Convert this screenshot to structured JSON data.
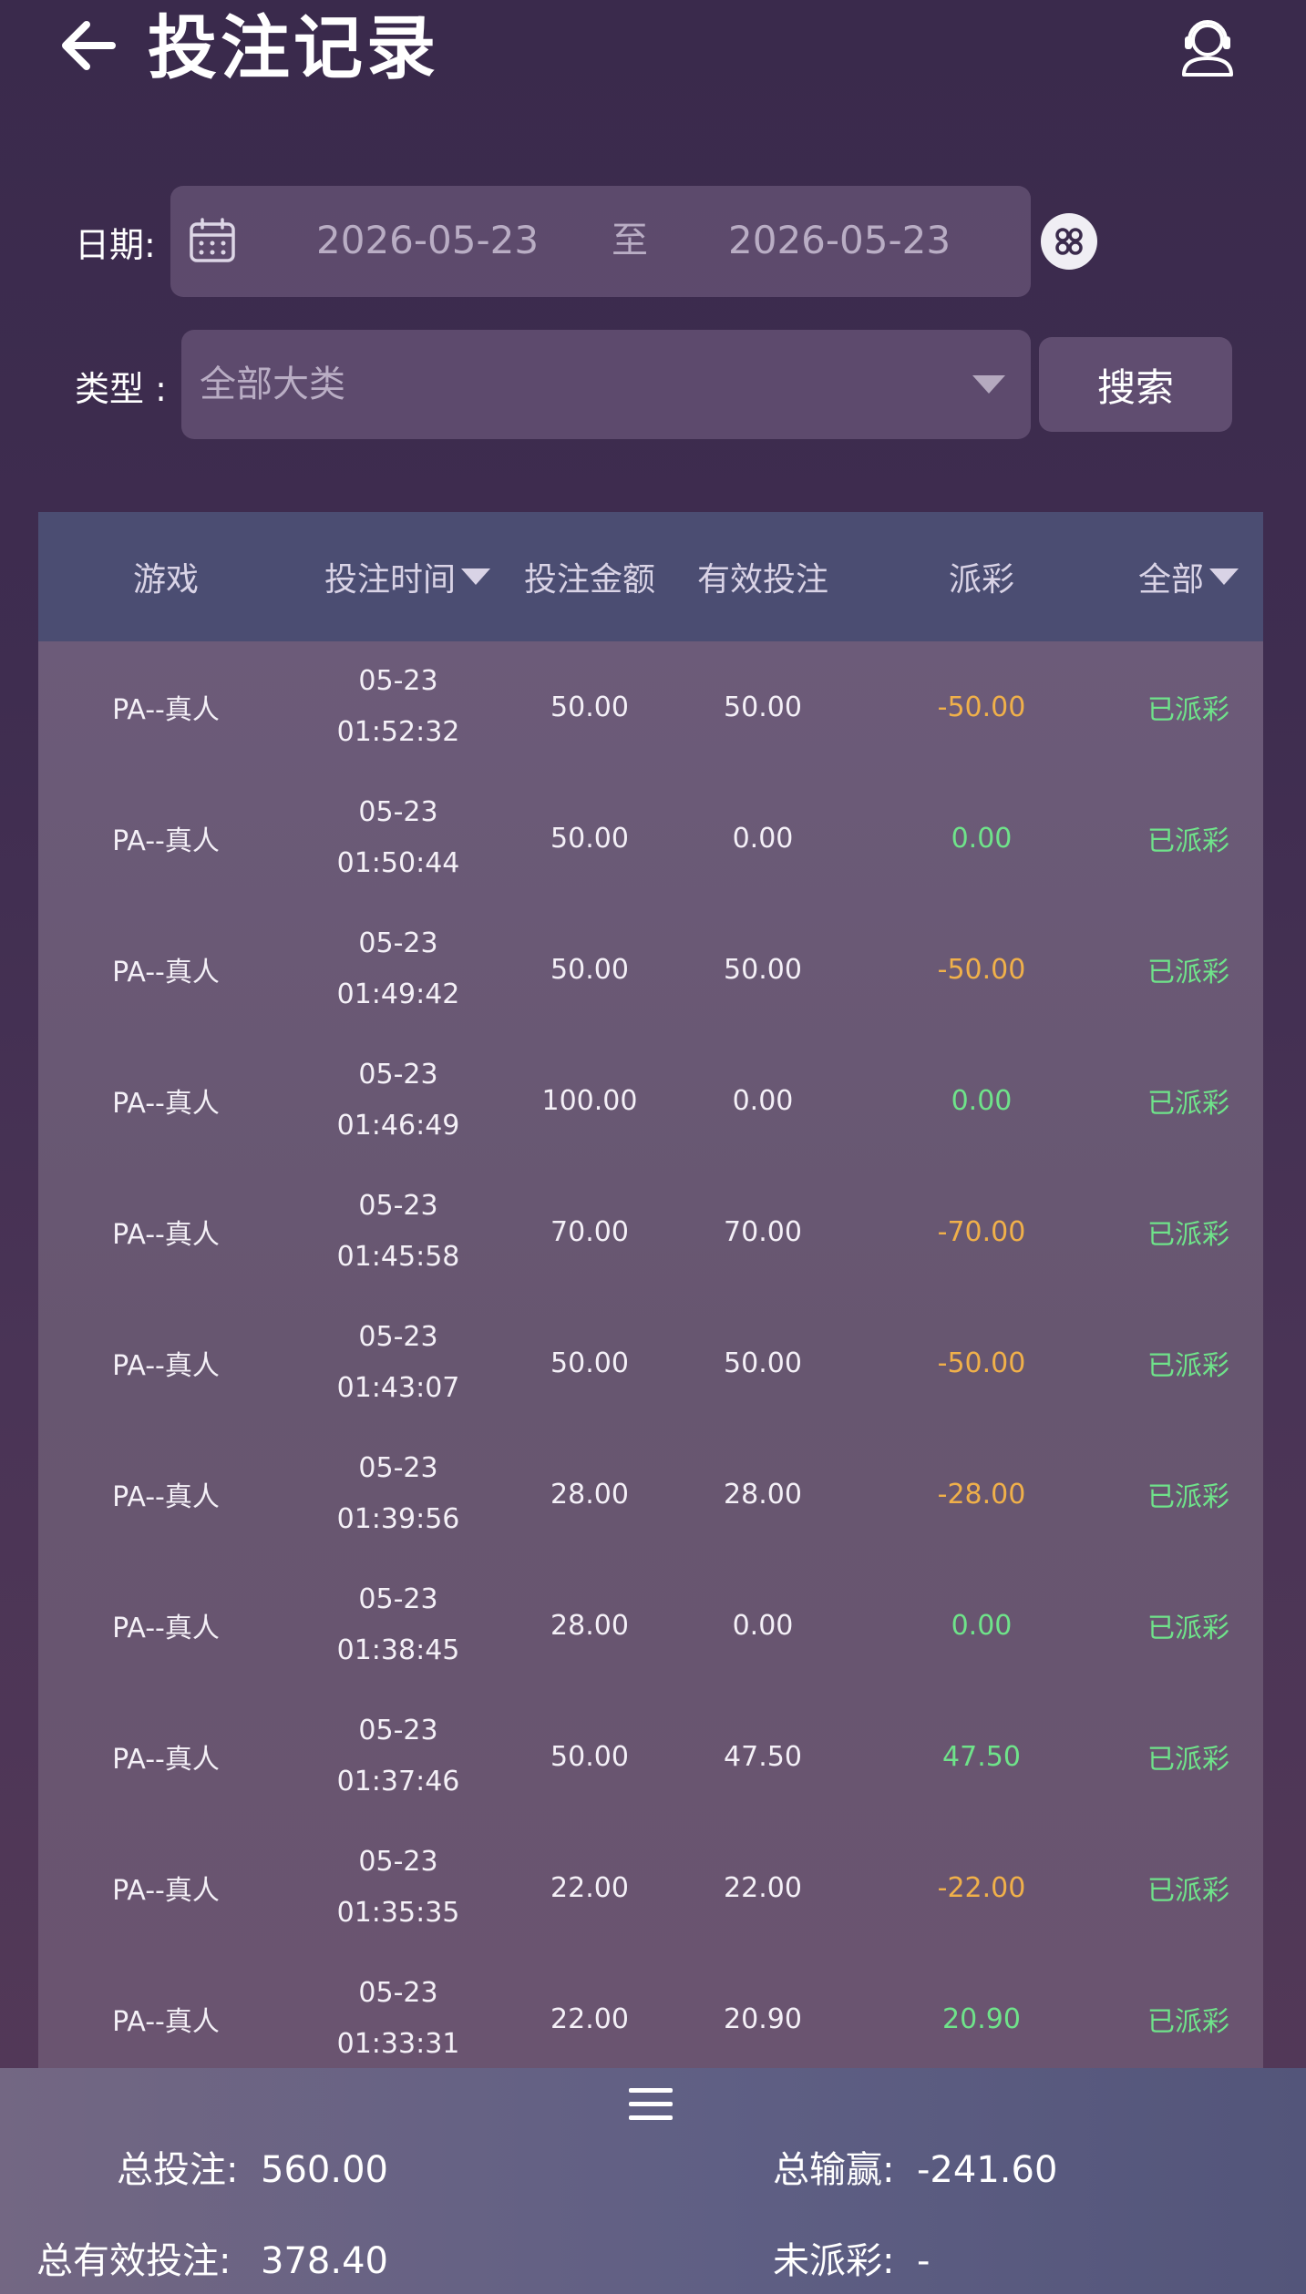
{
  "header": {
    "title": "投注记录"
  },
  "filters": {
    "date_label": "日期:",
    "date_start": "2026-05-23",
    "date_separator": "至",
    "date_end": "2026-05-23",
    "type_label": "类型 :",
    "type_value": "全部大类",
    "search_label": "搜索"
  },
  "table": {
    "headers": {
      "game": "游戏",
      "time": "投注时间",
      "amount": "投注金额",
      "valid": "有效投注",
      "payout": "派彩",
      "status": "全部"
    },
    "rows": [
      {
        "game": "PA--真人",
        "date": "05-23",
        "time": "01:52:32",
        "amount": "50.00",
        "valid": "50.00",
        "payout": "-50.00",
        "payout_sign": "neg",
        "status": "已派彩"
      },
      {
        "game": "PA--真人",
        "date": "05-23",
        "time": "01:50:44",
        "amount": "50.00",
        "valid": "0.00",
        "payout": "0.00",
        "payout_sign": "pos",
        "status": "已派彩"
      },
      {
        "game": "PA--真人",
        "date": "05-23",
        "time": "01:49:42",
        "amount": "50.00",
        "valid": "50.00",
        "payout": "-50.00",
        "payout_sign": "neg",
        "status": "已派彩"
      },
      {
        "game": "PA--真人",
        "date": "05-23",
        "time": "01:46:49",
        "amount": "100.00",
        "valid": "0.00",
        "payout": "0.00",
        "payout_sign": "pos",
        "status": "已派彩"
      },
      {
        "game": "PA--真人",
        "date": "05-23",
        "time": "01:45:58",
        "amount": "70.00",
        "valid": "70.00",
        "payout": "-70.00",
        "payout_sign": "neg",
        "status": "已派彩"
      },
      {
        "game": "PA--真人",
        "date": "05-23",
        "time": "01:43:07",
        "amount": "50.00",
        "valid": "50.00",
        "payout": "-50.00",
        "payout_sign": "neg",
        "status": "已派彩"
      },
      {
        "game": "PA--真人",
        "date": "05-23",
        "time": "01:39:56",
        "amount": "28.00",
        "valid": "28.00",
        "payout": "-28.00",
        "payout_sign": "neg",
        "status": "已派彩"
      },
      {
        "game": "PA--真人",
        "date": "05-23",
        "time": "01:38:45",
        "amount": "28.00",
        "valid": "0.00",
        "payout": "0.00",
        "payout_sign": "pos",
        "status": "已派彩"
      },
      {
        "game": "PA--真人",
        "date": "05-23",
        "time": "01:37:46",
        "amount": "50.00",
        "valid": "47.50",
        "payout": "47.50",
        "payout_sign": "pos",
        "status": "已派彩"
      },
      {
        "game": "PA--真人",
        "date": "05-23",
        "time": "01:35:35",
        "amount": "22.00",
        "valid": "22.00",
        "payout": "-22.00",
        "payout_sign": "neg",
        "status": "已派彩"
      },
      {
        "game": "PA--真人",
        "date": "05-23",
        "time": "01:33:31",
        "amount": "22.00",
        "valid": "20.90",
        "payout": "20.90",
        "payout_sign": "pos",
        "status": "已派彩"
      }
    ]
  },
  "summary": {
    "total_bet_label": "总投注:",
    "total_bet_value": "560.00",
    "total_winloss_label": "总输赢:",
    "total_winloss_value": "-241.60",
    "total_valid_label": "总有效投注:",
    "total_valid_value": "378.40",
    "unsettled_label": "未派彩:",
    "unsettled_value": "-"
  },
  "colors": {
    "negative_payout": "#f0b04a",
    "positive_payout": "#6fe38a",
    "status": "#6fe38a",
    "header_bar": "#4b4d72"
  },
  "icons": [
    "back-arrow-icon",
    "customer-service-icon",
    "calendar-icon",
    "quick-date-icon",
    "chevron-down-icon",
    "menu-icon"
  ]
}
